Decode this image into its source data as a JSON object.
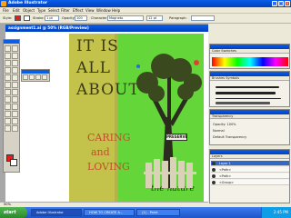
{
  "window": {
    "title": "Adobe Illustrator",
    "minimize": "_",
    "maximize": "□",
    "close": "x"
  },
  "menu": [
    "File",
    "Edit",
    "Object",
    "Type",
    "Select",
    "Filter",
    "Effect",
    "View",
    "Window",
    "Help"
  ],
  "options": {
    "style_label": "Style:",
    "stroke_label": "Stroke:",
    "stroke_value": "1 pt",
    "opacity_label": "Opacity:",
    "opacity_value": "100",
    "font_label": "Character:",
    "font_value": "Magneto",
    "size_value": "12 pt",
    "paragraph_label": "Paragraph:",
    "fill_color": "#e02020"
  },
  "document": {
    "title": "assignment1.ai @ 50% (RGB/Preview)"
  },
  "poster": {
    "line1": "IT IS",
    "line2": "ALL",
    "line3": "ABOUT",
    "line4": "CARING",
    "line5": "and",
    "line6": "LOVING",
    "line7": "the nature",
    "sign": "PRESERVE",
    "colors": {
      "green": "#64d63a",
      "yellow": "#c3c24a",
      "red": "#c0502a"
    }
  },
  "panels": {
    "color": {
      "tabs": "Color  Swatches"
    },
    "brushes": {
      "tabs": "Brushes  Symbols"
    },
    "transparency": {
      "tabs": "Transparency",
      "opacity": "Opacity: 100%",
      "row1": "Normal",
      "row2": "Default Transparency"
    },
    "layers": {
      "tabs": "Layers",
      "rows": [
        {
          "name": "Layer 1",
          "selected": true
        },
        {
          "name": "<Path>",
          "selected": false
        },
        {
          "name": "<Path>",
          "selected": false
        },
        {
          "name": "<Group>",
          "selected": false
        }
      ]
    }
  },
  "status": {
    "zoom": "50%"
  },
  "taskbar": {
    "start": "start",
    "tasks": [
      "Adobe Illustrator",
      "HOW TO CREATE A...",
      "(1) - Paint"
    ],
    "time": "2:45 PM"
  }
}
